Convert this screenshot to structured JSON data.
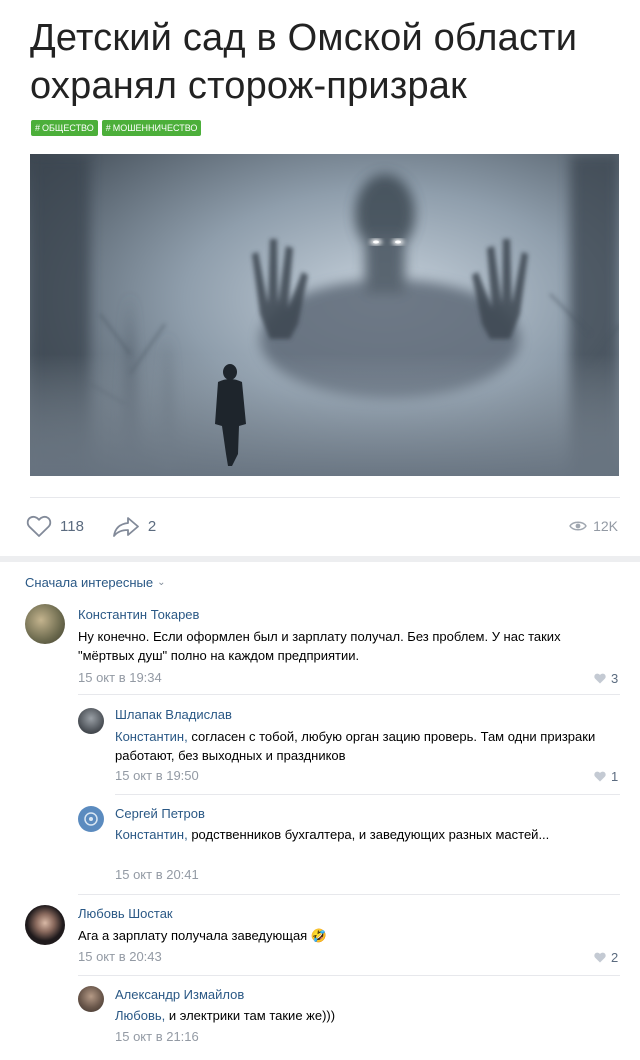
{
  "post": {
    "title": "Детский сад в Омской области охранял сторож-призрак",
    "tags": [
      "общество",
      "мошенничество"
    ],
    "image_desc_icon": "ghost-photo"
  },
  "actions": {
    "likes": "118",
    "shares": "2",
    "views": "12K"
  },
  "comments_sort": "Сначала интересные",
  "comments": [
    {
      "author": "Константин Токарев",
      "reply_to": "",
      "text": "Ну конечно. Если оформлен был и зарплату получал. Без проблем. У нас таких \"мёртвых душ\" полно на каждом предприятии.",
      "date": "15 окт в 19:34",
      "likes": "3"
    },
    {
      "author": "Шлапак Владислав",
      "reply_to": "Константин,",
      "text": " согласен с тобой, любую орган зацию проверь. Там одни призраки работают, без выходных и праздников",
      "date": "15 окт в 19:50",
      "likes": "1"
    },
    {
      "author": "Сергей Петров",
      "reply_to": "Константин,",
      "text": " родственников бухгалтера, и заведующих разных мастей...",
      "date": "15 окт в 20:41",
      "likes": ""
    },
    {
      "author": "Любовь Шостак",
      "reply_to": "",
      "text": "Ага а зарплату получала заведующая",
      "emoji": "🤣",
      "date": "15 окт в 20:43",
      "likes": "2"
    },
    {
      "author": "Александр Измайлов",
      "reply_to": "Любовь,",
      "text": " и электрики там такие же)))",
      "date": "15 окт в 21:16",
      "likes": ""
    }
  ],
  "colors": {
    "link": "#2a5885",
    "tag_green": "#4caf3a",
    "muted": "#939aa4"
  }
}
